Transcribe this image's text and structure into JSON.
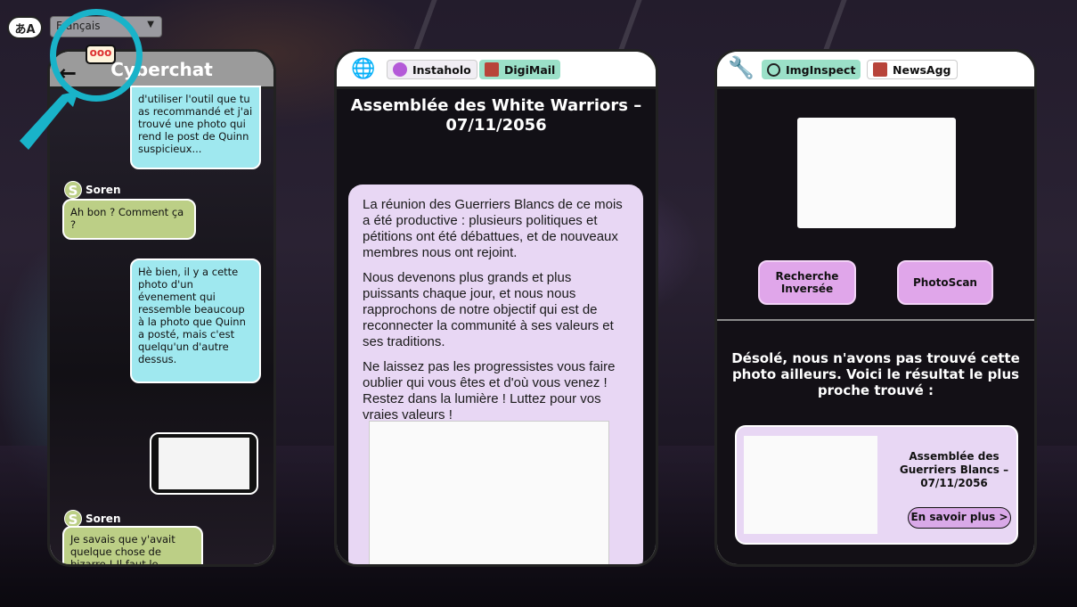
{
  "language": {
    "icon": "translate-icon",
    "icon_text": "あA",
    "selected": "Français"
  },
  "chat": {
    "title": "Cyberchat",
    "back_icon": "back-arrow-icon",
    "typing_icon_text": "ooo",
    "messages": [
      {
        "from": "me",
        "text": "d'utiliser l'outil que tu as recommandé et j'ai trouvé une photo qui rend le post de Quinn suspicieux..."
      },
      {
        "from": "Soren",
        "avatar": "S",
        "text": "Ah bon ? Comment ça ?"
      },
      {
        "from": "me",
        "text": "Hè bien, il y a cette photo d'un évenement qui ressemble beaucoup à la photo que Quinn a posté, mais c'est quelqu'un d'autre dessus."
      },
      {
        "from": "me",
        "type": "image"
      },
      {
        "from": "Soren",
        "avatar": "S",
        "text": "Je savais que y'avait quelque chose de bizarre ! Il faut le montrer aux autres !"
      }
    ]
  },
  "article": {
    "tabs": [
      {
        "label": "Instaholo",
        "icon": "instaholo-icon",
        "color": "#b45ad8"
      },
      {
        "label": "DigiMail",
        "icon": "digimail-icon",
        "color": "#b8443a"
      }
    ],
    "title": "Assemblée des White Warriors – 07/11/2056",
    "paragraphs": [
      "La réunion des Guerriers Blancs de ce mois a été productive : plusieurs politiques et pétitions ont été débattues, et de nouveaux membres nous ont rejoint.",
      "Nous devenons plus grands et plus puissants chaque jour, et nous nous rapprochons de notre objectif qui est de reconnecter la communité à ses valeurs et ses traditions.",
      "Ne laissez pas les progressistes vous faire oublier qui vous êtes et d'où vous venez ! Restez dans la lumière ! Luttez pour vos vraies valeurs !"
    ]
  },
  "inspect": {
    "tabs": [
      {
        "label": "ImgInspect",
        "icon": "magnifier-icon",
        "color": "#9be0c8"
      },
      {
        "label": "NewsAgg",
        "icon": "newsagg-icon",
        "color": "#ffffff"
      }
    ],
    "buttons": {
      "reverse_search": "Recherche Inversée",
      "photoscan": "PhotoScan"
    },
    "result_message": "Désolé, nous n'avons pas trouvé cette photo ailleurs. Voici le résultat le plus proche trouvé :",
    "result": {
      "title": "Assemblée des Guerriers Blancs – 07/11/2056",
      "more_label": "En savoir plus >"
    }
  },
  "colors": {
    "chat_out": "#9fe8ef",
    "chat_in": "#bccf86",
    "card_bg": "#e8d7f4",
    "button_bg": "#e0a6ea",
    "highlight": "#19b3c9"
  }
}
